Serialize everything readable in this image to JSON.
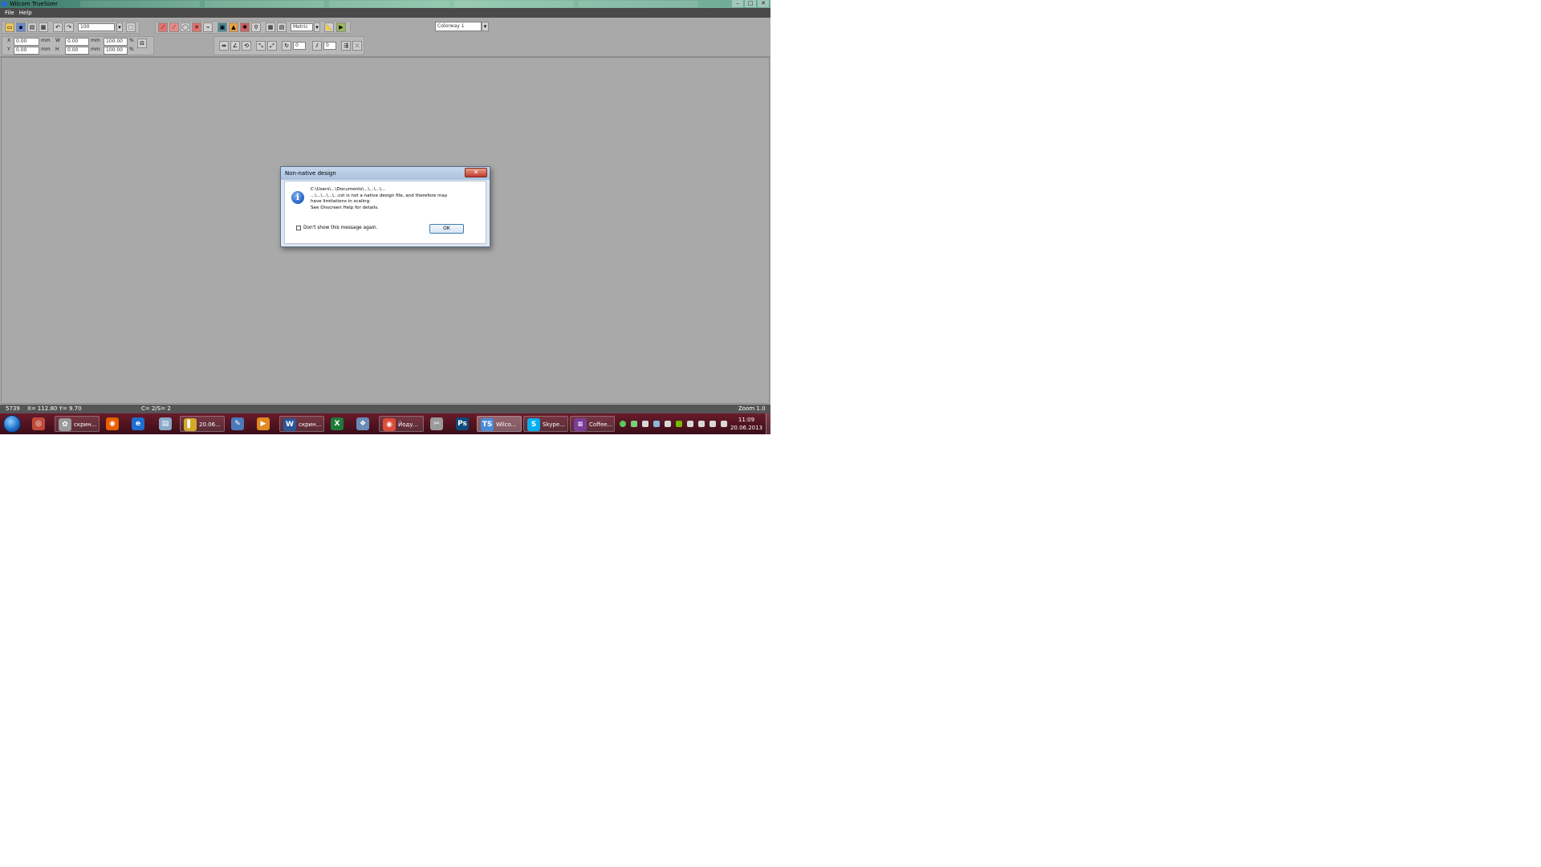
{
  "window": {
    "title": "Wilcom TrueSizer",
    "buttons": {
      "minimize": "–",
      "maximize": "□",
      "close": "✕"
    }
  },
  "menu": [
    "File",
    "Help"
  ],
  "toolbar": {
    "zoom_field": "100",
    "units_select": "Metric",
    "colorway_select": "Colorway 1",
    "x_label": "X",
    "y_label": "Y",
    "x_value": "0.00",
    "y_value": "0.00",
    "w_label": "W",
    "h_label": "H",
    "w_value": "0.00",
    "h_value": "0.00",
    "mm_1": "mm",
    "mm_2": "mm",
    "mm_3": "mm",
    "mm_4": "mm",
    "scale_w": "100.00",
    "scale_h": "100.00",
    "pct_1": "%",
    "pct_2": "%",
    "angle_field": "0",
    "slant_field": "0"
  },
  "status": {
    "stitches": "5739",
    "coords": "X= 112.80 Y= 9.70",
    "colors": "C= 2/S= 2",
    "zoom": "Zoom 1.0"
  },
  "dialog": {
    "title": "Non-native design",
    "close_glyph": "✕",
    "info_glyph": "i",
    "message_line1": "C:\\Users\\...\\Documents\\...\\...\\...\\...",
    "message_line2": "...\\...\\...\\...\\...cst is not a native design file, and therefore may",
    "message_line3": "have limitations in scaling.",
    "message_line4": "See Onscreen Help for details.",
    "checkbox_label": "Don't show this message again.",
    "ok_label": "OK"
  },
  "taskbar": {
    "items": [
      {
        "label": "скрин...",
        "icon": "✿",
        "color": "#9a9a9a"
      },
      {
        "label": "20.06...",
        "icon": "▌",
        "color": "#d4a82a"
      },
      {
        "label": "скрин...",
        "icon": "W",
        "color": "#2b579a"
      },
      {
        "label": "Йоду...",
        "icon": "◉",
        "color": "#dd4b39"
      },
      {
        "label": "Wilco...",
        "icon": "TS",
        "color": "#4a8bd8"
      },
      {
        "label": "Skype...",
        "icon": "S",
        "color": "#00aff0"
      },
      {
        "label": "Coffee...",
        "icon": "≡",
        "color": "#7a3d9a"
      }
    ],
    "pinned": [
      {
        "icon": "◎",
        "color": "#c04a3a"
      },
      {
        "icon": "◉",
        "color": "#e66000"
      },
      {
        "icon": "e",
        "color": "#1e6fd0"
      },
      {
        "icon": "▤",
        "color": "#8aa8c8"
      },
      {
        "icon": "✎",
        "color": "#4a7ab8"
      },
      {
        "icon": "▶",
        "color": "#e08a20"
      },
      {
        "icon": "X",
        "color": "#1e7a3a"
      },
      {
        "icon": "❖",
        "color": "#6a8ab8"
      },
      {
        "icon": "✂",
        "color": "#9a9a9a"
      },
      {
        "icon": "Ps",
        "color": "#0e4a7a"
      }
    ],
    "clock_time": "11:09",
    "clock_date": "20.06.2013"
  }
}
